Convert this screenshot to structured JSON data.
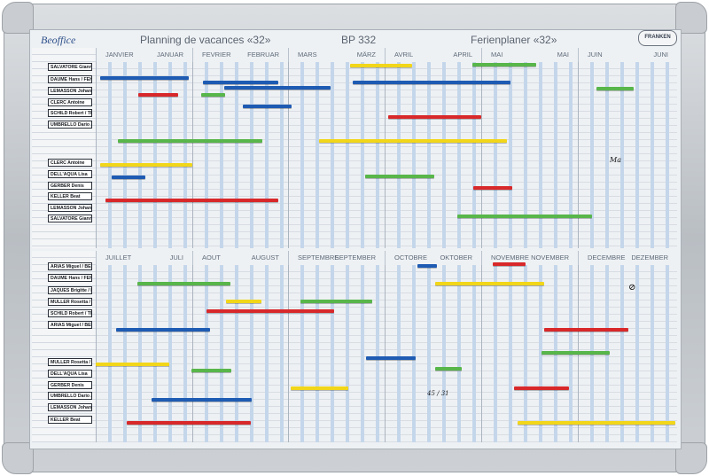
{
  "titles": [
    "Planning de vacances «32»",
    "BP 332",
    "Ferienplaner «32»"
  ],
  "brand": "Beoffice",
  "manufacturer": "FRANKEN",
  "top_months": [
    {
      "fr": "JANVIER",
      "de": "JANUAR"
    },
    {
      "fr": "FEVRIER",
      "de": "FEBRUAR"
    },
    {
      "fr": "MARS",
      "de": "MÄRZ"
    },
    {
      "fr": "AVRIL",
      "de": "APRIL"
    },
    {
      "fr": "MAI",
      "de": "MAI"
    },
    {
      "fr": "JUIN",
      "de": "JUNI"
    }
  ],
  "bottom_months": [
    {
      "fr": "JUILLET",
      "de": "JULI"
    },
    {
      "fr": "AOUT",
      "de": "AUGUST"
    },
    {
      "fr": "SEPTEMBRE",
      "de": "SEPTEMBER"
    },
    {
      "fr": "OCTOBRE",
      "de": "OKTOBER"
    },
    {
      "fr": "NOVEMBRE",
      "de": "NOVEMBER"
    },
    {
      "fr": "DECEMBRE",
      "de": "DEZEMBER"
    }
  ],
  "top_names": [
    "SALVATORE Gianni",
    "DAUME Hans / FEHR Anita",
    "LEMASSON Johan",
    "CLERC Antoine",
    "SCHILD Robert / THIEL André",
    "UMBRELLO Dario / ZAUGG Céline",
    "CLERC Antoine",
    "DELL'AQUA Lisa",
    "GERBER Denis",
    "KELLER Beat",
    "LEMASSON Johan",
    "SALVATORE Gianni"
  ],
  "bottom_names": [
    "ARIAS Miguel / BERTRAND Yvette",
    "DAUME Hans / FEHR Anita",
    "JAQUES Brigitte / LOMBARDO Pia",
    "MULLER Rosetta / RODUIT Daniel",
    "SCHILD Robert / THIEL André",
    "ARIAS Miguel / BERTRAND Yvette",
    "MULLER Rosetta / RODUIT Daniel",
    "DELL'AQUA Lisa",
    "GERBER Denis",
    "UMBRELLO Dario / ZAUGG Céline",
    "LEMASSON Johan",
    "KELLER Beat"
  ],
  "marker_colors": {
    "blue": "#1e5bb3",
    "red": "#d8282a",
    "green": "#58b64a",
    "yellow": "#f2d619"
  },
  "scribbles": [
    "Ma",
    "45 / 31"
  ]
}
